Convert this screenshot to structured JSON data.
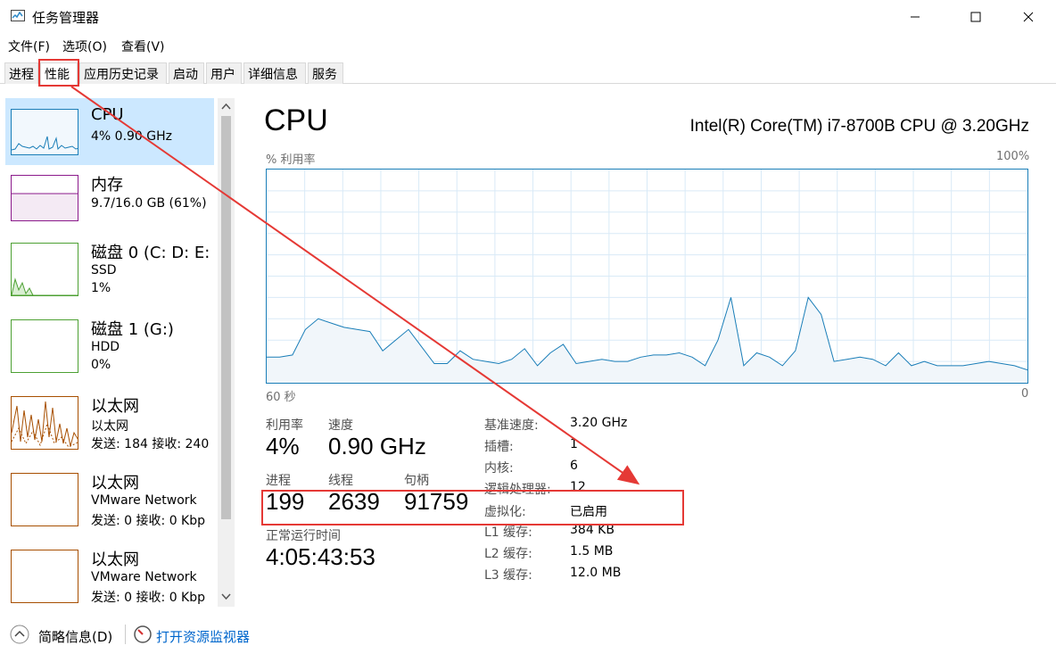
{
  "window": {
    "title": "任务管理器"
  },
  "menu": [
    "文件(F)",
    "选项(O)",
    "查看(V)"
  ],
  "tabs": [
    "进程",
    "性能",
    "应用历史记录",
    "启动",
    "用户",
    "详细信息",
    "服务"
  ],
  "active_tab": "性能",
  "sidebar": [
    {
      "title": "CPU",
      "lines": [
        "4% 0.90 GHz"
      ],
      "color": "#1a7eb8",
      "selected": true
    },
    {
      "title": "内存",
      "lines": [
        "9.7/16.0 GB (61%)"
      ],
      "color": "#8b1a8b"
    },
    {
      "title": "磁盘 0 (C: D: E:",
      "lines": [
        "SSD",
        "1%"
      ],
      "color": "#4da033"
    },
    {
      "title": "磁盘 1 (G:)",
      "lines": [
        "HDD",
        "0%"
      ],
      "color": "#4da033"
    },
    {
      "title": "以太网",
      "lines": [
        "以太网",
        "发送: 184 接收: 240"
      ],
      "color": "#a74f01"
    },
    {
      "title": "以太网",
      "lines": [
        "VMware Network",
        "发送: 0 接收: 0 Kbp"
      ],
      "color": "#a74f01"
    },
    {
      "title": "以太网",
      "lines": [
        "VMware Network",
        "发送: 0 接收: 0 Kbp"
      ],
      "color": "#a74f01"
    }
  ],
  "main": {
    "title": "CPU",
    "model": "Intel(R) Core(TM) i7-8700B CPU @ 3.20GHz",
    "graph_label_left": "% 利用率",
    "graph_label_right": "100%",
    "time_left": "60 秒",
    "time_right": "0",
    "utilization_label": "利用率",
    "utilization": "4%",
    "speed_label": "速度",
    "speed": "0.90 GHz",
    "processes_label": "进程",
    "processes": "199",
    "threads_label": "线程",
    "threads": "2639",
    "handles_label": "句柄",
    "handles": "91759",
    "uptime_label": "正常运行时间",
    "uptime": "4:05:43:53",
    "info": [
      {
        "label": "基准速度:",
        "value": "3.20 GHz"
      },
      {
        "label": "插槽:",
        "value": "1"
      },
      {
        "label": "内核:",
        "value": "6"
      },
      {
        "label": "逻辑处理器:",
        "value": "12"
      },
      {
        "label": "虚拟化:",
        "value": "已启用"
      },
      {
        "label": "L1 缓存:",
        "value": "384 KB"
      },
      {
        "label": "L2 缓存:",
        "value": "1.5 MB"
      },
      {
        "label": "L3 缓存:",
        "value": "12.0 MB"
      }
    ]
  },
  "cpu_history_percent": [
    12,
    12,
    13,
    25,
    30,
    28,
    26,
    25,
    24,
    15,
    20,
    25,
    17,
    9,
    9,
    15,
    11,
    10,
    9,
    11,
    16,
    8,
    14,
    18,
    9,
    10,
    11,
    10,
    10,
    12,
    13,
    13,
    14,
    12,
    8,
    20,
    40,
    8,
    14,
    12,
    8,
    15,
    40,
    32,
    10,
    11,
    12,
    11,
    8,
    14,
    8,
    10,
    8,
    8,
    8,
    9,
    10,
    9,
    8,
    6
  ],
  "footer": {
    "brief_label": "简略信息(D)",
    "monitor_label": "打开资源监视器"
  }
}
